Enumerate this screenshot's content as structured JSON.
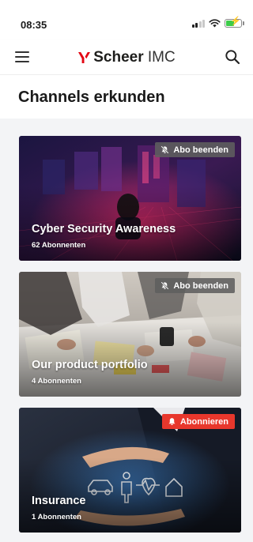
{
  "status_bar": {
    "time": "08:35"
  },
  "header": {
    "logo_bold": "Scheer",
    "logo_light": "IMC",
    "brand_color": "#e30613"
  },
  "page": {
    "title": "Channels erkunden"
  },
  "channels": [
    {
      "title": "Cyber Security Awareness",
      "subscribers": "62 Abonnenten",
      "action": "Abo beenden",
      "action_state": "subscribed",
      "image": "cyber-security-image"
    },
    {
      "title": "Our product portfolio",
      "subscribers": "4 Abonnenten",
      "action": "Abo beenden",
      "action_state": "subscribed",
      "image": "team-meeting-image"
    },
    {
      "title": "Insurance",
      "subscribers": "1 Abonnenten",
      "action": "Abonnieren",
      "action_state": "not-subscribed",
      "image": "insurance-hands-image"
    }
  ],
  "colors": {
    "subscribe": "#e8372c",
    "unsubscribe": "#5f5f5f"
  },
  "icons": {
    "menu": "hamburger-icon",
    "search": "search-icon",
    "unsubscribe": "bell-slash-icon",
    "subscribe": "bell-icon"
  }
}
